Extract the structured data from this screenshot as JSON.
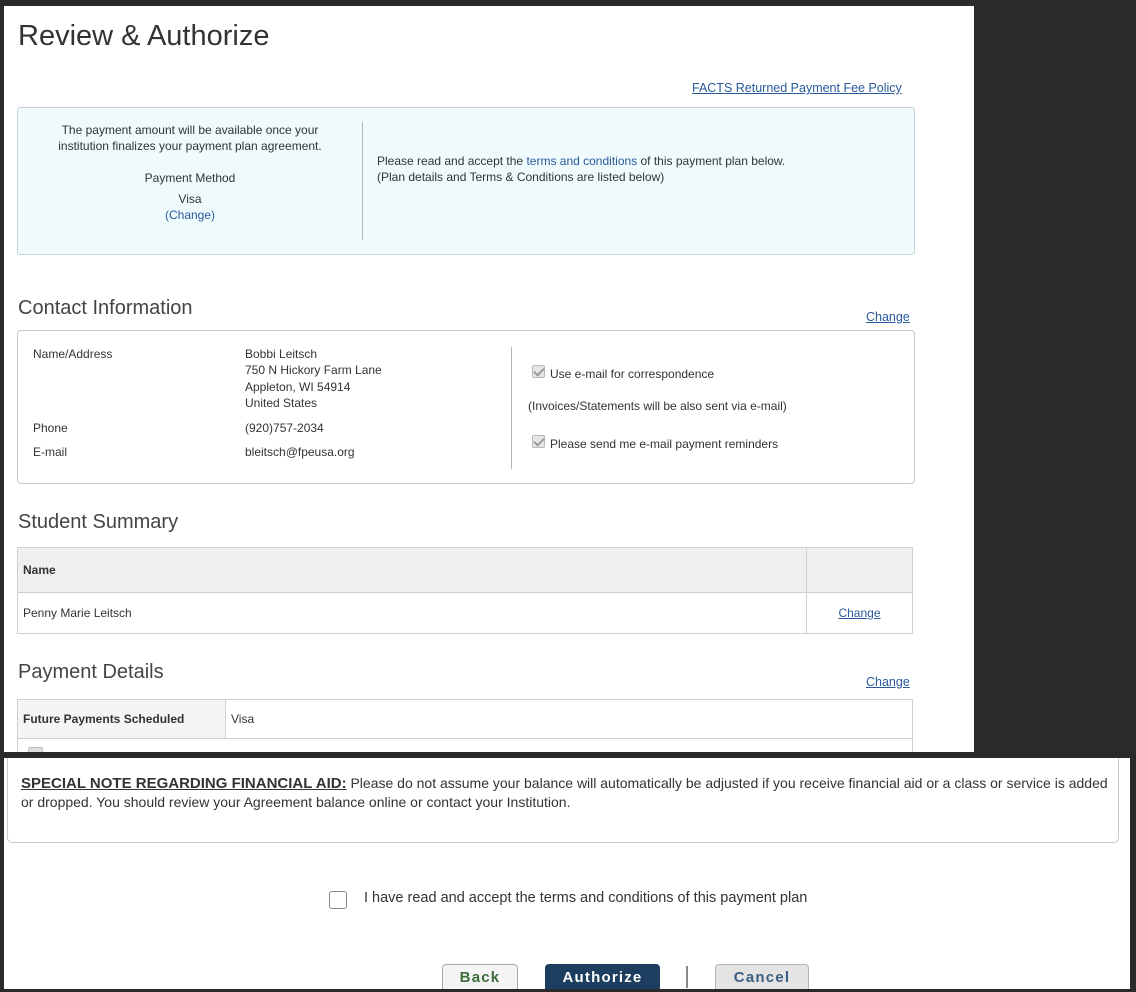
{
  "page": {
    "title": "Review & Authorize",
    "fee_policy_link": "FACTS Returned Payment Fee Policy"
  },
  "info_box": {
    "availability_line1": "The payment amount will be available once your",
    "availability_line2": "institution finalizes your payment plan agreement.",
    "payment_method_label": "Payment Method",
    "payment_method_value": "Visa",
    "change_link": "(Change)",
    "terms_prefix": "Please read and accept the ",
    "terms_link": "terms and conditions",
    "terms_suffix": " of this payment plan below.",
    "terms_line2": "(Plan details and Terms & Conditions are listed below)"
  },
  "contact": {
    "section_title": "Contact Information",
    "change_link": "Change",
    "name_address_label": "Name/Address",
    "name": "Bobbi Leitsch",
    "street": "750 N Hickory Farm Lane",
    "city_state_zip": "Appleton, WI 54914",
    "country": "United States",
    "phone_label": "Phone",
    "phone": "(920)757-2034",
    "email_label": "E-mail",
    "email": "bleitsch@fpeusa.org",
    "use_email_option": "Use e-mail for correspondence",
    "invoices_note": "(Invoices/Statements will be also sent via e-mail)",
    "reminders_option": "Please send me e-mail payment reminders"
  },
  "student_summary": {
    "section_title": "Student Summary",
    "name_header": "Name",
    "student_name": "Penny Marie Leitsch",
    "change_link": "Change"
  },
  "payment_details": {
    "section_title": "Payment Details",
    "change_link": "Change",
    "future_payments_label": "Future Payments Scheduled",
    "future_payments_value": "Visa"
  },
  "financial_aid": {
    "heading": "SPECIAL NOTE REGARDING FINANCIAL AID:",
    "text": " Please do not assume your balance will automatically be adjusted if you receive financial aid or a class or service is added or dropped. You should review your Agreement balance online or contact your Institution."
  },
  "accept": {
    "label": "I have read and accept the terms and conditions of this payment plan"
  },
  "buttons": {
    "back": "Back",
    "authorize": "Authorize",
    "cancel": "Cancel"
  }
}
